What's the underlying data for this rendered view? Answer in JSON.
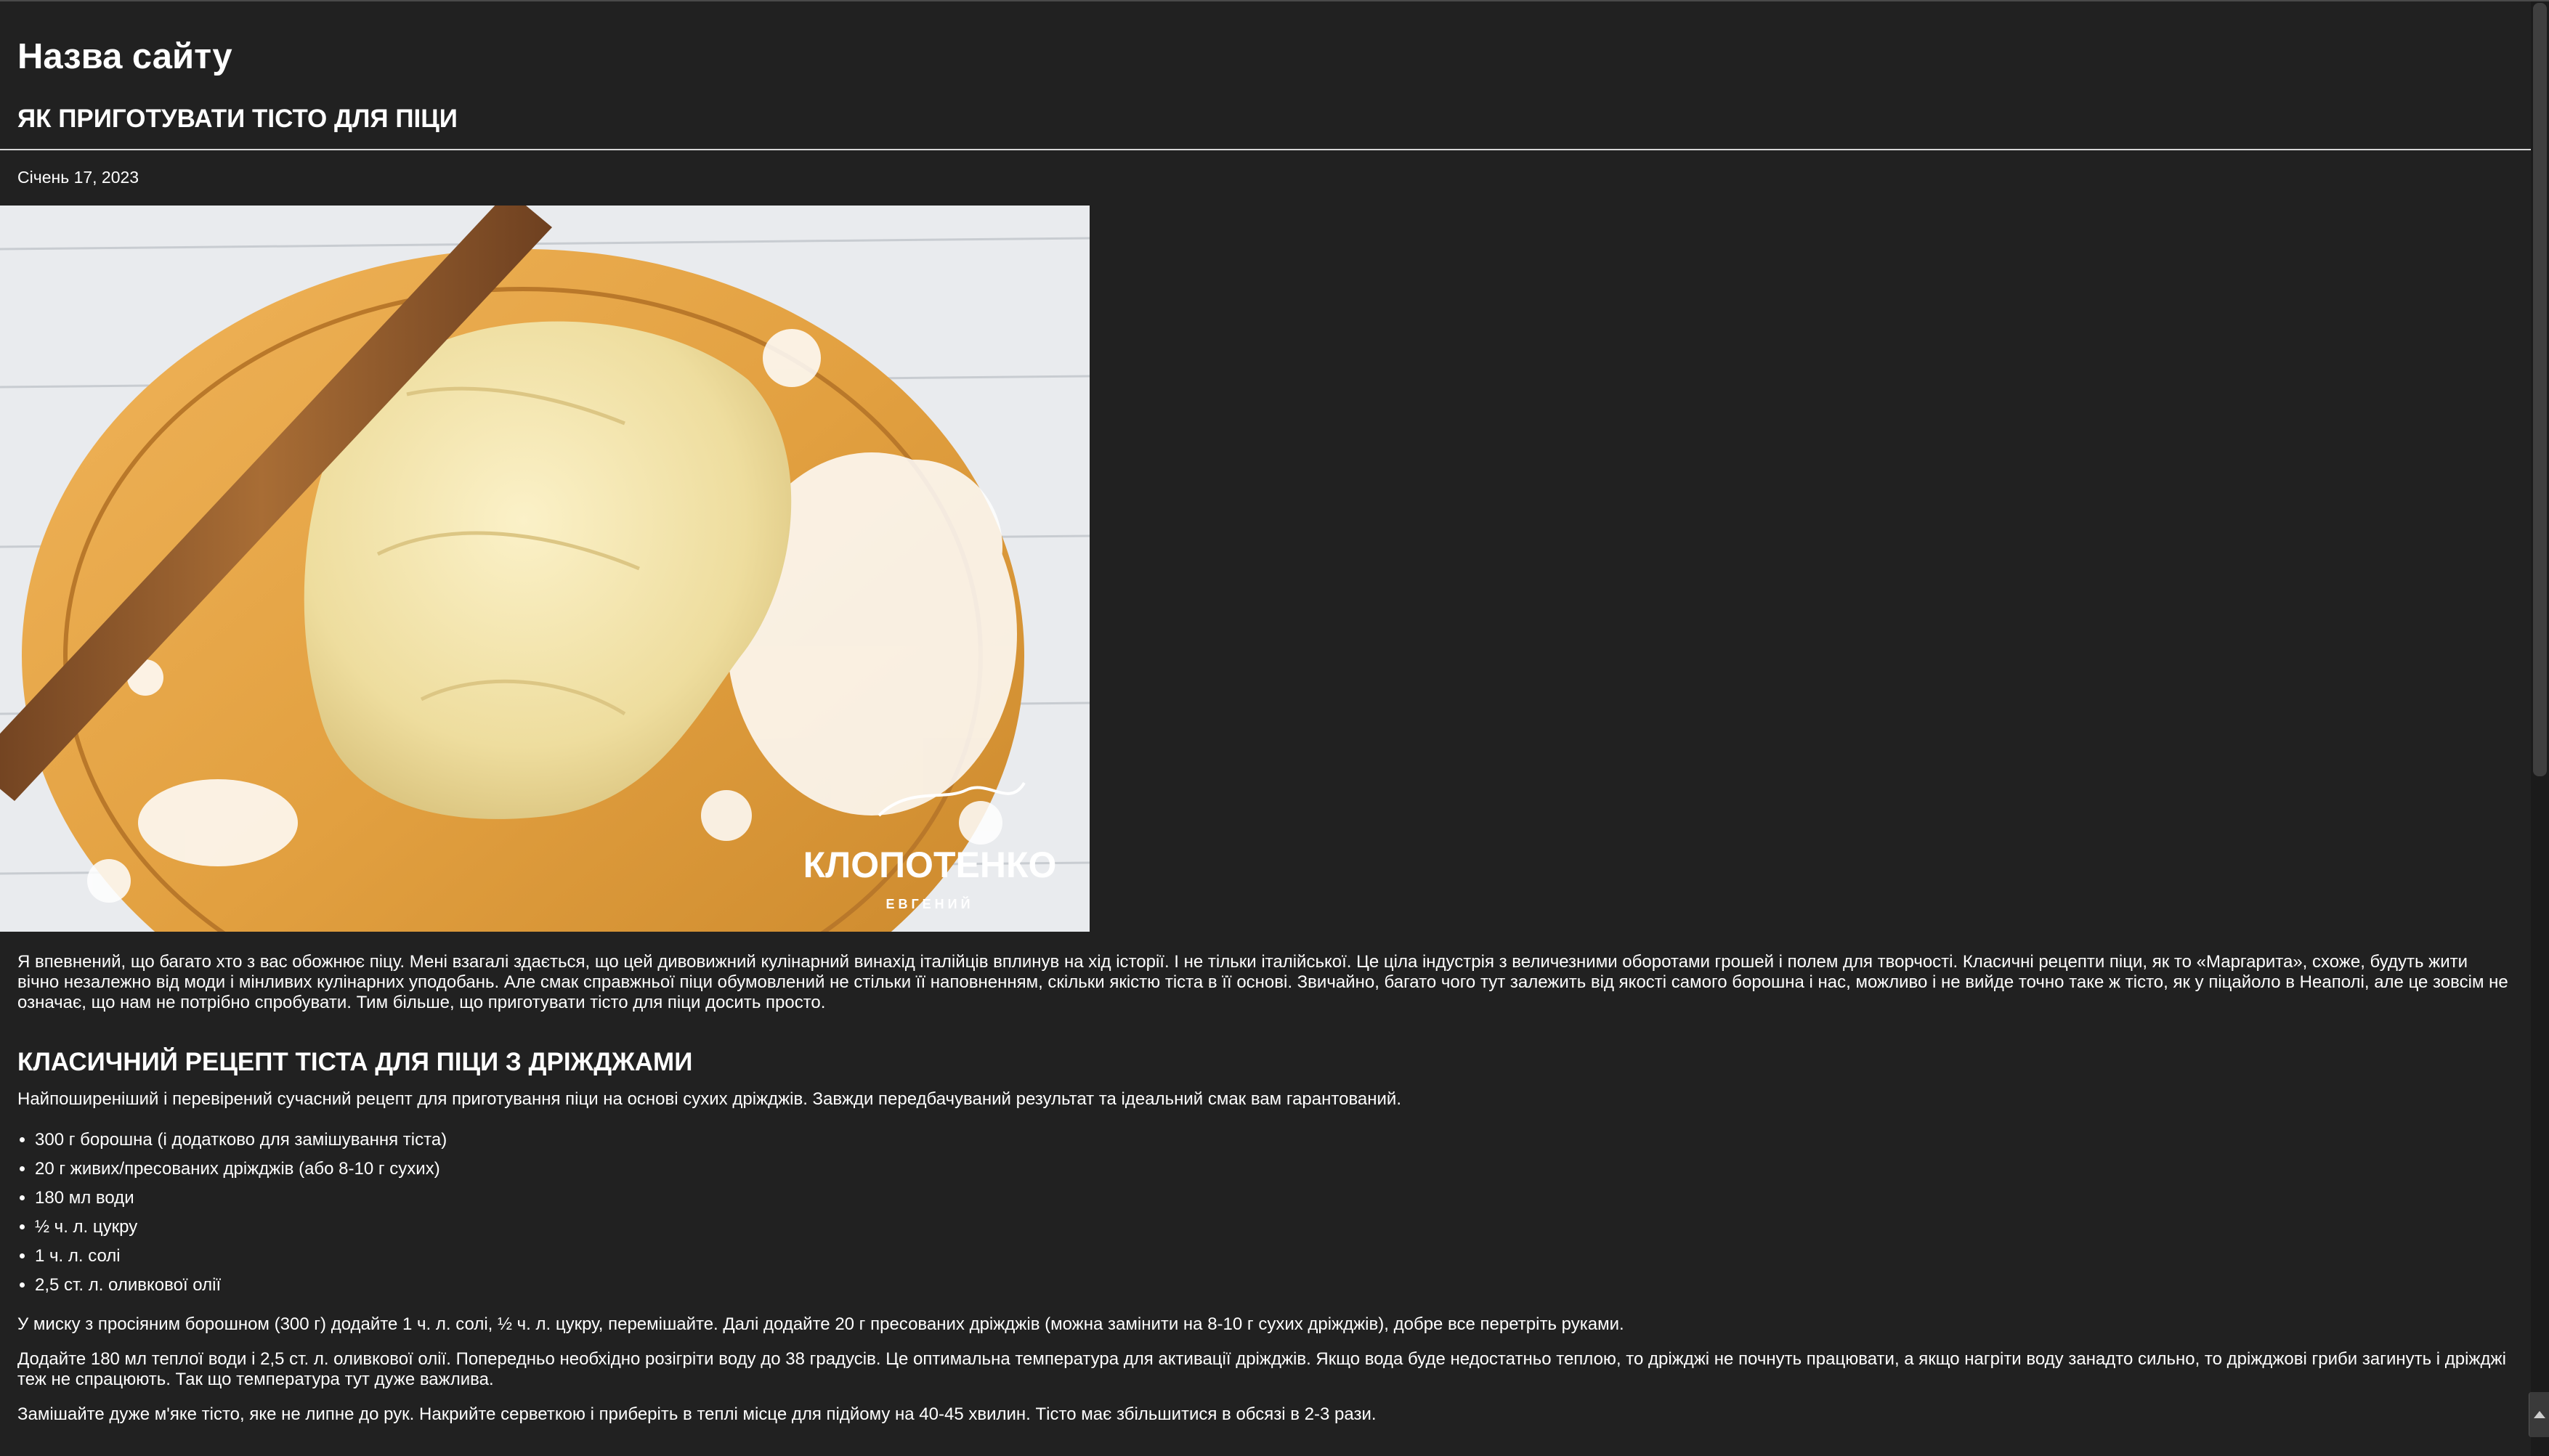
{
  "site": {
    "title": "Назва сайту"
  },
  "post": {
    "title": "ЯК ПРИГОТУВАТИ ТІСТО ДЛЯ ПІЦИ",
    "date": "Січень 17, 2023",
    "image": {
      "logo_text": "КЛОПОТЕНКО",
      "logo_subtext": "ЕВГЕНИЙ"
    },
    "intro": "Я впевнений, що багато хто з вас обожнює піцу. Мені взагалі здається, що цей дивовижний кулінарний винахід італійців вплинув на хід історії. І не тільки італійської. Це ціла індустрія з величезними оборотами грошей і полем для творчості. Класичні рецепти піци, як то «Маргарита», схоже, будуть жити вічно незалежно від моди і мінливих кулінарних уподобань. Але смак справжньої піци обумовлений не стільки її наповненням, скільки якістю тіста в її основі. Звичайно, багато чого тут залежить від якості самого борошна і нас, можливо і не вийде точно таке ж тісто, як у піцайоло в Неаполі, але це зовсім не означає, що нам не потрібно спробувати. Тим більше, що приготувати тісто для піци досить просто.",
    "section": {
      "title": "КЛАСИЧНИЙ РЕЦЕПТ ТІСТА ДЛЯ ПІЦИ З ДРІЖДЖАМИ",
      "lead": "Найпоширеніший і перевірений сучасний рецепт для приготування піци на основі сухих дріжджів. Завжди передбачуваний результат та ідеальний смак вам гарантований.",
      "ingredients": [
        "300 г борошна (і додатково для замішування тіста)",
        "20 г живих/пресованих дріжджів (або 8-10 г сухих)",
        "180 мл води",
        "½ ч. л. цукру",
        "1 ч. л. солі",
        "2,5 ст. л. оливкової олії"
      ],
      "steps": [
        "У миску з просіяним борошном (300 г) додайте 1 ч. л. солі, ½ ч. л. цукру, перемішайте. Далі додайте 20 г пресованих дріжджів (можна замінити на 8-10 г сухих дріжджів), добре все перетріть руками.",
        "Додайте 180 мл теплої води і 2,5 ст. л. оливкової олії. Попередньо необхідно розігріти воду до 38 градусів. Це оптимальна температура для активації дріжджів. Якщо вода буде недостатньо теплою, то дріжджі не почнуть працювати, а якщо нагріти воду занадто сильно, то дріжджові гриби загинуть і дріжджі теж не спрацюють. Так що температура тут дуже важлива.",
        "Замішайте дуже м'яке тісто, яке не липне до рук. Накрийте серветкою і приберіть в теплі місце для підйому на 40-45 хвилин. Тісто має збільшитися в обсязі в 2-3 рази."
      ]
    }
  },
  "colors": {
    "background": "#212121",
    "text": "#ffffff",
    "divider": "#d6d6d6"
  }
}
